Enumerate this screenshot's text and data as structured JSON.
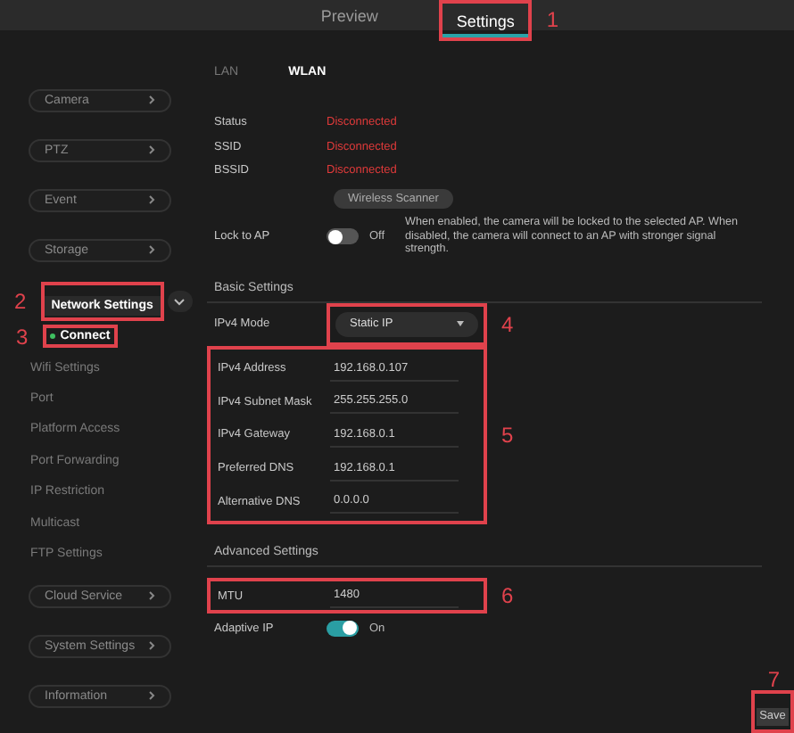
{
  "top_tabs": [
    {
      "label": "Preview",
      "selected": false
    },
    {
      "label": "Settings",
      "selected": true,
      "callout": "1"
    }
  ],
  "sidebar": {
    "items": [
      {
        "label": "Camera",
        "expanded": false
      },
      {
        "label": "PTZ",
        "expanded": false
      },
      {
        "label": "Event",
        "expanded": false
      },
      {
        "label": "Storage",
        "expanded": false
      },
      {
        "label": "Network Settings",
        "expanded": true,
        "callout": "2",
        "children": [
          {
            "label": "Connect",
            "selected": true,
            "callout": "3"
          },
          {
            "label": "Wifi Settings",
            "selected": false
          },
          {
            "label": "Port",
            "selected": false
          },
          {
            "label": "Platform Access",
            "selected": false
          },
          {
            "label": "Port Forwarding",
            "selected": false
          },
          {
            "label": "IP Restriction",
            "selected": false
          },
          {
            "label": "Multicast",
            "selected": false
          },
          {
            "label": "FTP Settings",
            "selected": false
          }
        ]
      },
      {
        "label": "Cloud Service",
        "expanded": false
      },
      {
        "label": "System Settings",
        "expanded": false
      },
      {
        "label": "Information",
        "expanded": false
      }
    ]
  },
  "network_tabs": [
    {
      "label": "LAN",
      "selected": false
    },
    {
      "label": "WLAN",
      "selected": true
    }
  ],
  "status_rows": [
    {
      "label": "Status",
      "value": "Disconnected"
    },
    {
      "label": "SSID",
      "value": "Disconnected"
    },
    {
      "label": "BSSID",
      "value": "Disconnected"
    }
  ],
  "scan_button": "Wireless Scanner",
  "lock_to_ap": {
    "label": "Lock to AP",
    "on": false,
    "state_label": "Off",
    "description": "When enabled, the camera will be locked to the selected AP. When disabled, the camera will connect to an AP with stronger signal strength."
  },
  "basic_settings": {
    "title": "Basic Settings",
    "ipv4_mode": {
      "label": "IPv4 Mode",
      "value": "Static IP",
      "callout": "4"
    },
    "fields_callout": "5",
    "fields": [
      {
        "label": "IPv4 Address",
        "value": "192.168.0.107"
      },
      {
        "label": "IPv4 Subnet Mask",
        "value": "255.255.255.0"
      },
      {
        "label": "IPv4 Gateway",
        "value": "192.168.0.1"
      },
      {
        "label": "Preferred DNS",
        "value": "192.168.0.1"
      },
      {
        "label": "Alternative DNS",
        "value": "0.0.0.0"
      }
    ]
  },
  "advanced_settings": {
    "title": "Advanced Settings",
    "mtu": {
      "label": "MTU",
      "value": "1480",
      "callout": "6"
    },
    "adaptive_ip": {
      "label": "Adaptive IP",
      "on": true,
      "state_label": "On"
    }
  },
  "save_button": {
    "label": "Save",
    "callout": "7"
  }
}
